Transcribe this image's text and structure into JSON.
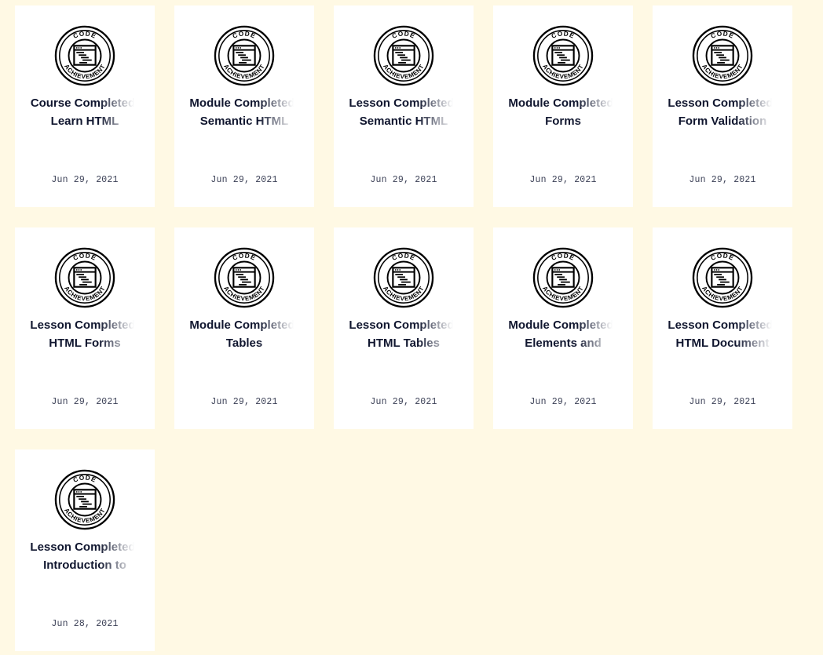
{
  "badge": {
    "top_text": "CODE",
    "bottom_text": "ACHIEVEMENT",
    "icon": "code-achievement-badge-icon",
    "ink_color": "#000000"
  },
  "colors": {
    "page_background": "#fff9e4",
    "card_background": "#ffffff",
    "title_color": "#10162f",
    "date_color": "#3a3f55"
  },
  "achievements": [
    {
      "title": "Course Completed: Learn HTML",
      "date": "Jun 29, 2021"
    },
    {
      "title": "Module Completed: Semantic HTML",
      "date": "Jun 29, 2021"
    },
    {
      "title": "Lesson Completed: Semantic HTML",
      "date": "Jun 29, 2021"
    },
    {
      "title": "Module Completed: Forms",
      "date": "Jun 29, 2021"
    },
    {
      "title": "Lesson Completed: Form Validation",
      "date": "Jun 29, 2021"
    },
    {
      "title": "Lesson Completed: HTML Forms",
      "date": "Jun 29, 2021"
    },
    {
      "title": "Module Completed: Tables",
      "date": "Jun 29, 2021"
    },
    {
      "title": "Lesson Completed: HTML Tables",
      "date": "Jun 29, 2021"
    },
    {
      "title": "Module Completed: Elements and",
      "date": "Jun 29, 2021"
    },
    {
      "title": "Lesson Completed: HTML Document",
      "date": "Jun 29, 2021"
    },
    {
      "title": "Lesson Completed: Introduction to",
      "date": "Jun 28, 2021"
    }
  ]
}
